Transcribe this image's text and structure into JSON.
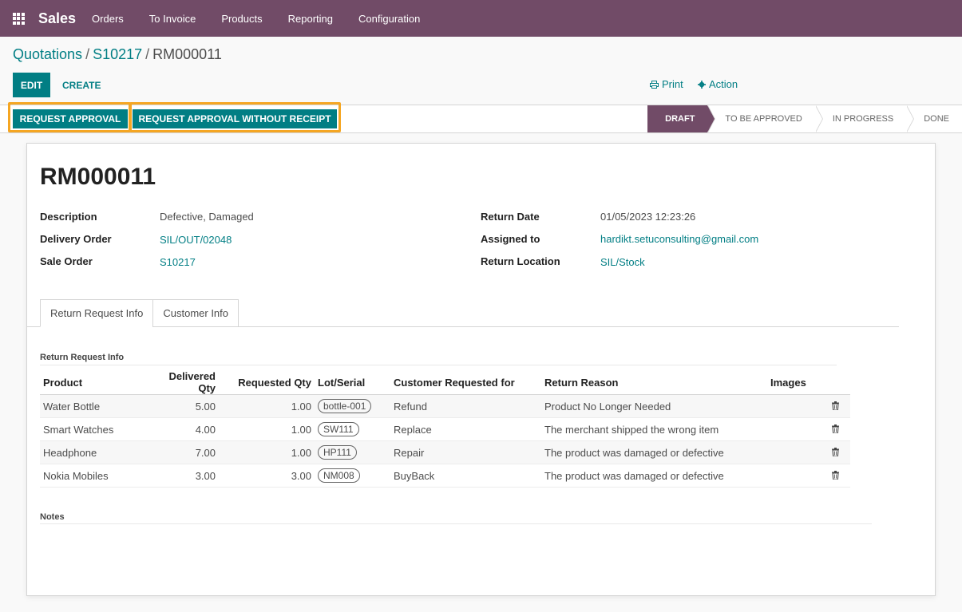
{
  "navbar": {
    "app_name": "Sales",
    "menu": [
      "Orders",
      "To Invoice",
      "Products",
      "Reporting",
      "Configuration"
    ]
  },
  "breadcrumb": {
    "items": [
      "Quotations",
      "S10217"
    ],
    "current": "RM000011"
  },
  "control": {
    "edit_label": "EDIT",
    "create_label": "CREATE",
    "print_label": "Print",
    "action_label": "Action"
  },
  "header_buttons": {
    "request_approval": "REQUEST APPROVAL",
    "request_approval_without_receipt": "REQUEST APPROVAL WITHOUT RECEIPT"
  },
  "stages": {
    "items": [
      "DRAFT",
      "TO BE APPROVED",
      "IN PROGRESS",
      "DONE"
    ],
    "active": "DRAFT"
  },
  "form": {
    "title": "RM000011",
    "left": [
      {
        "label": "Description",
        "value": "Defective, Damaged"
      },
      {
        "label": "Delivery Order",
        "value": "SIL/OUT/02048"
      },
      {
        "label": "Sale Order",
        "value": "S10217"
      }
    ],
    "right": [
      {
        "label": "Return Date",
        "value": "01/05/2023 12:23:26"
      },
      {
        "label": "Assigned to",
        "value": "hardikt.setuconsulting@gmail.com"
      },
      {
        "label": "Return Location",
        "value": "SIL/Stock"
      }
    ]
  },
  "tabs": [
    "Return Request Info",
    "Customer Info"
  ],
  "section_title": "Return Request Info",
  "table": {
    "headers": [
      "Product",
      "Delivered Qty",
      "Requested Qty",
      "Lot/Serial",
      "Customer Requested for",
      "Return Reason",
      "Images"
    ],
    "rows": [
      {
        "product": "Water Bottle",
        "delivered": "5.00",
        "requested": "1.00",
        "lot": "bottle-001",
        "requested_for": "Refund",
        "reason": "Product No Longer Needed"
      },
      {
        "product": "Smart Watches",
        "delivered": "4.00",
        "requested": "1.00",
        "lot": "SW111",
        "requested_for": "Replace",
        "reason": "The merchant shipped the wrong item"
      },
      {
        "product": "Headphone",
        "delivered": "7.00",
        "requested": "1.00",
        "lot": "HP111",
        "requested_for": "Repair",
        "reason": "The product was damaged or defective"
      },
      {
        "product": "Nokia Mobiles",
        "delivered": "3.00",
        "requested": "3.00",
        "lot": "NM008",
        "requested_for": "BuyBack",
        "reason": "The product was damaged or defective"
      }
    ]
  },
  "notes_label": "Notes",
  "colors": {
    "brand": "#714b67",
    "primary": "#017e84",
    "highlight": "#f5a623"
  }
}
